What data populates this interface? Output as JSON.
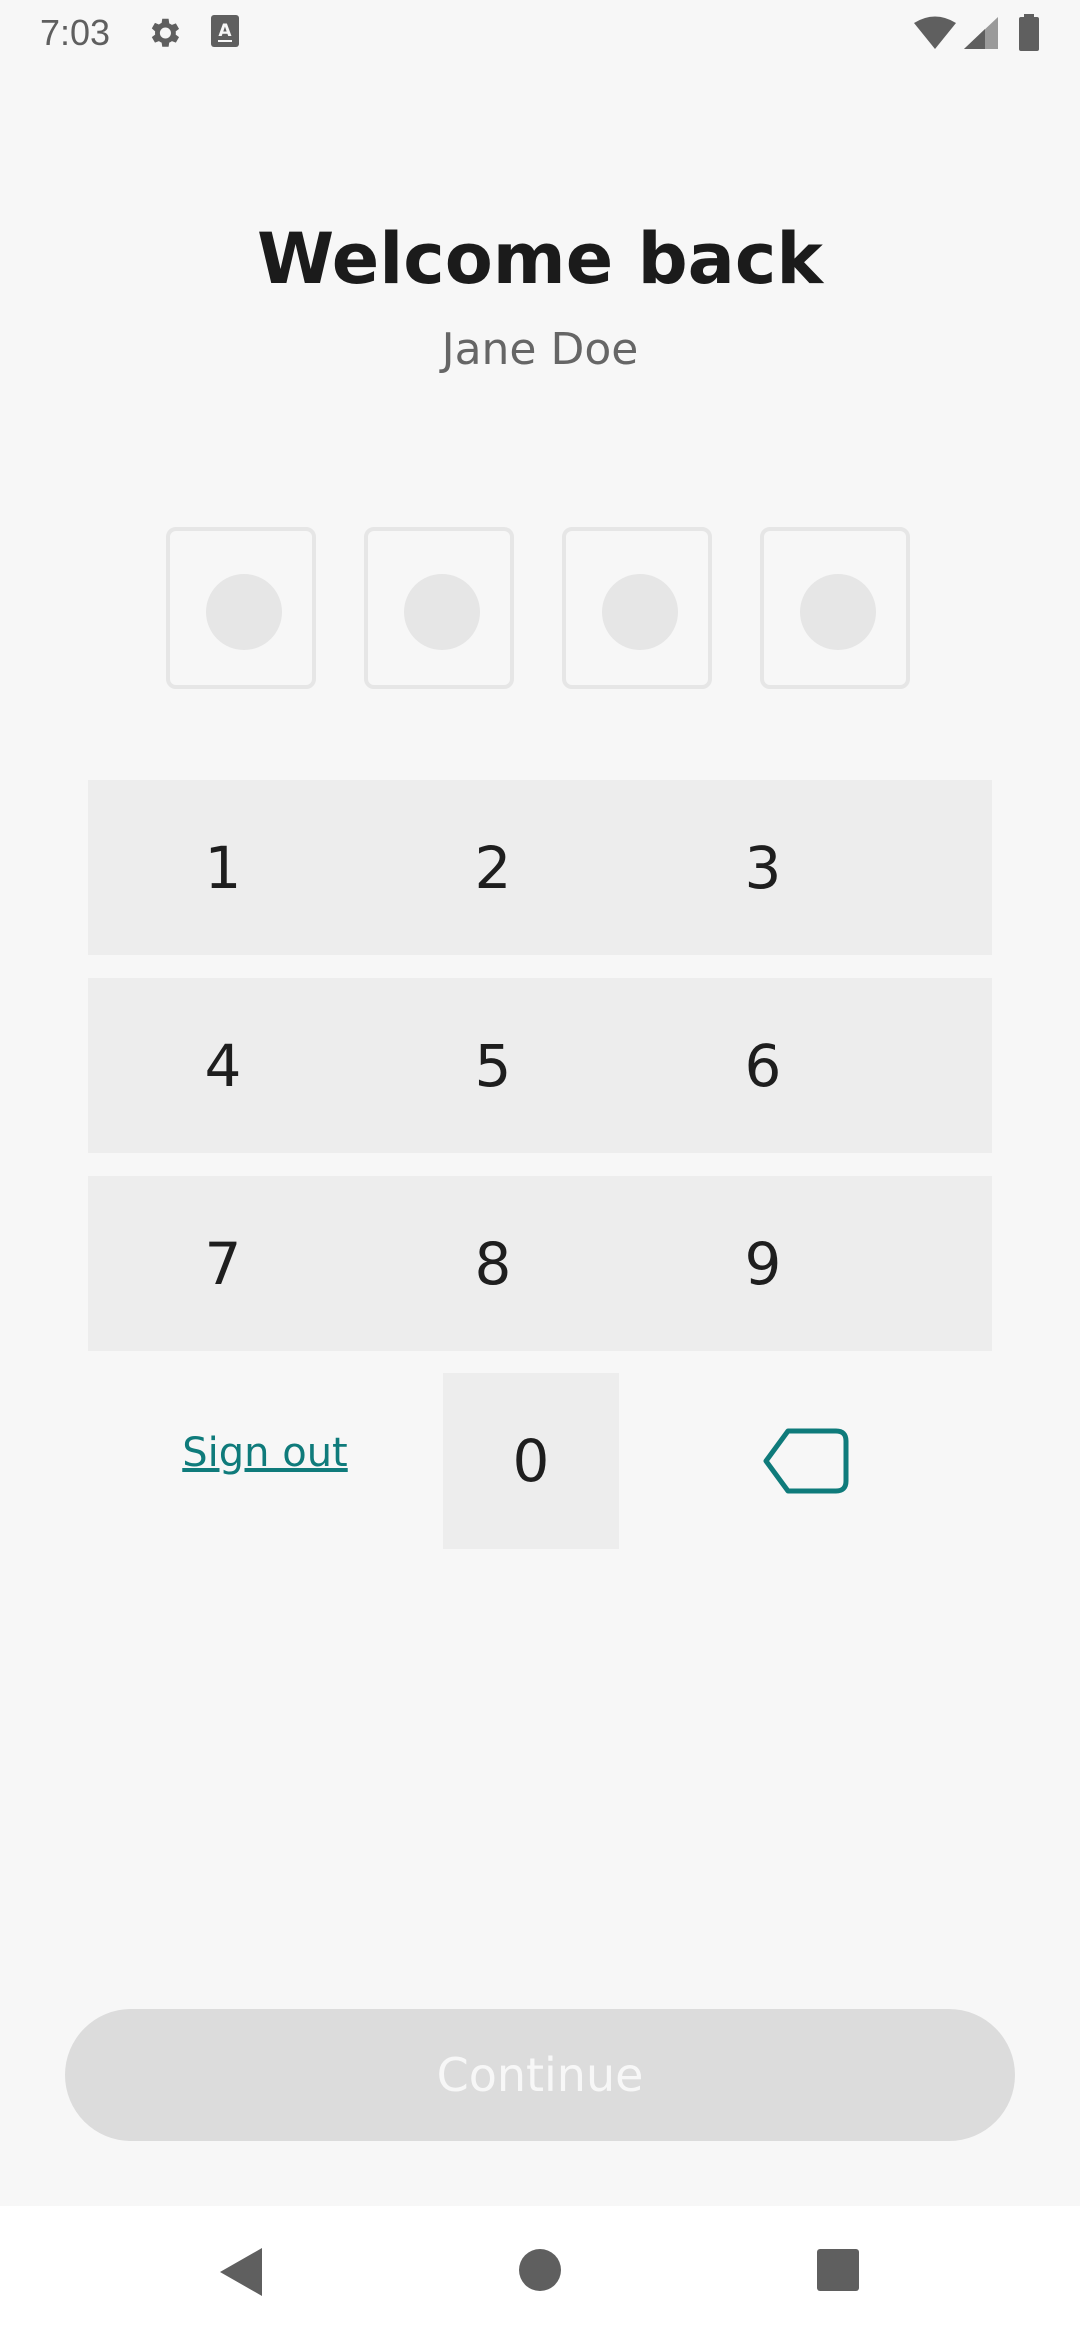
{
  "status_bar": {
    "time": "7:03",
    "left_icons": [
      "gear-icon",
      "keyboard-a-icon"
    ],
    "right_icons": [
      "wifi-icon",
      "cell-signal-icon",
      "battery-icon"
    ]
  },
  "header": {
    "title": "Welcome back",
    "subtitle": "Jane Doe"
  },
  "pin": {
    "length": 4,
    "filled": 0
  },
  "keypad": {
    "rows": [
      [
        "1",
        "2",
        "3"
      ],
      [
        "4",
        "5",
        "6"
      ],
      [
        "7",
        "8",
        "9"
      ]
    ],
    "zero": "0",
    "sign_out": "Sign out",
    "backspace_icon": "backspace-icon"
  },
  "continue_button": {
    "label": "Continue",
    "enabled": false
  },
  "nav_bar": {
    "icons": [
      "back-triangle-icon",
      "home-circle-icon",
      "recents-square-icon"
    ]
  },
  "colors": {
    "accent": "#0f7b7b",
    "background": "#f7f7f7",
    "key_background": "#ededed",
    "disabled_button": "#dcdcdc"
  }
}
